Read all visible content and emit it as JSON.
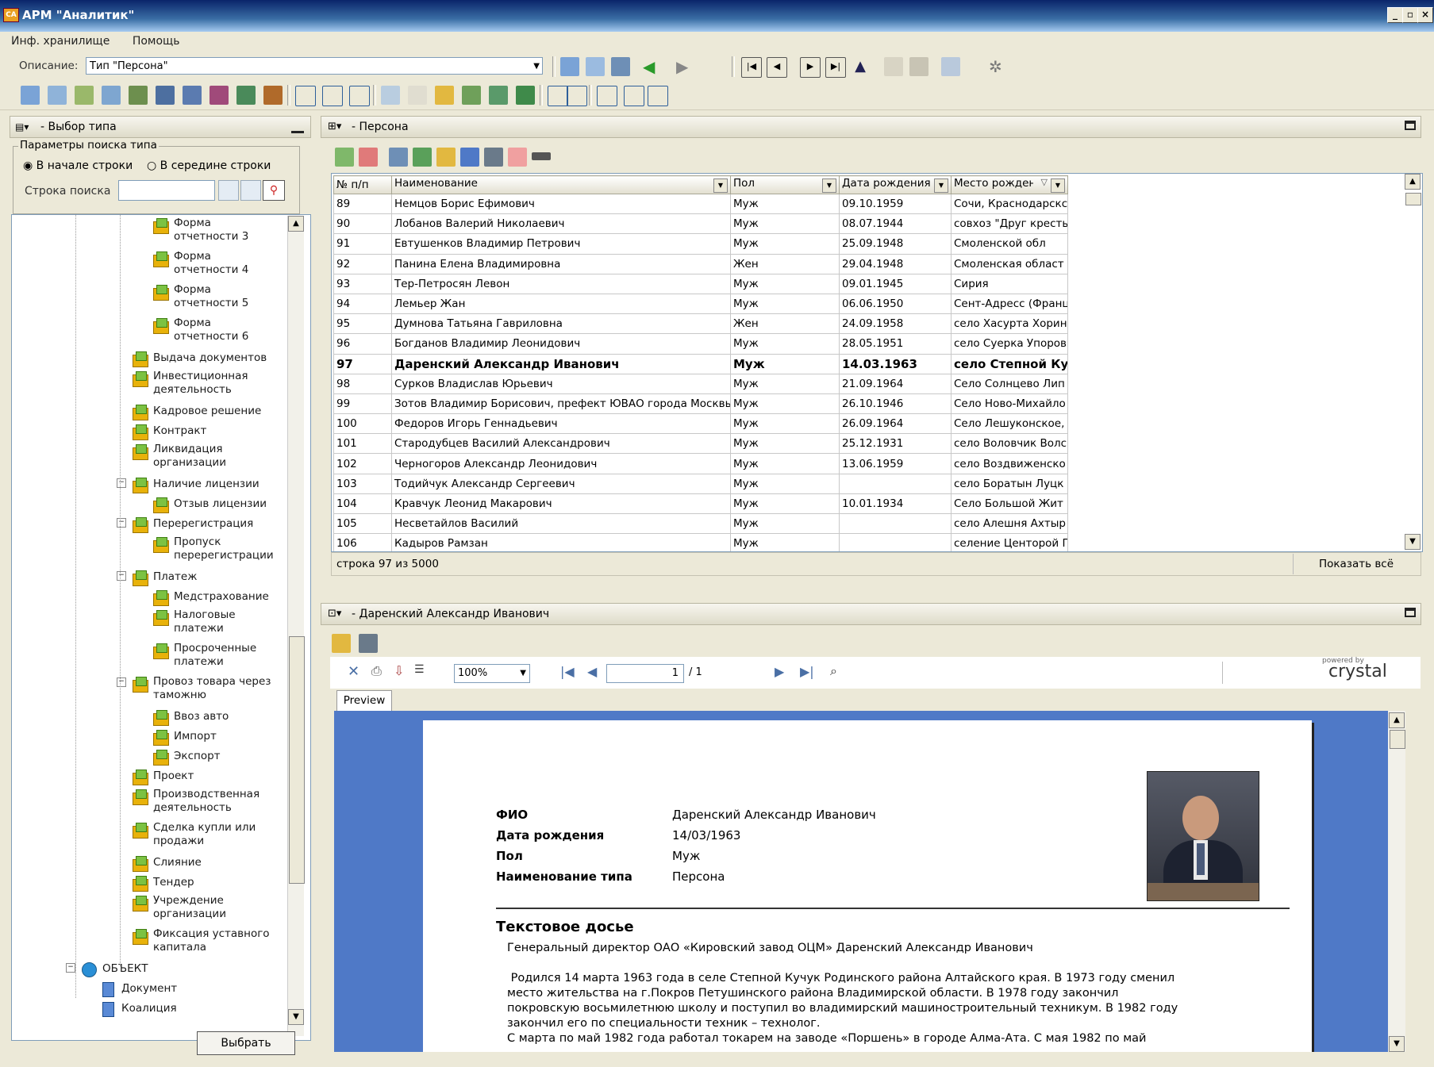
{
  "window": {
    "title": "АРМ \"Аналитик\""
  },
  "menu": [
    "Инф. хранилище",
    "Помощь"
  ],
  "toolbar": {
    "description_label": "Описание:",
    "description_value": "Тип \"Персона\""
  },
  "left_panel": {
    "title": "- Выбор типа",
    "search_group": "Параметры поиска типа",
    "radio_start": "В начале строки",
    "radio_middle": "В середине строки",
    "search_label": "Строка поиска",
    "search_value": "",
    "select_button": "Выбрать",
    "tree": [
      {
        "label": "Форма\nотчетности 3",
        "level": 3
      },
      {
        "label": "Форма\nотчетности 4",
        "level": 3
      },
      {
        "label": "Форма\nотчетности 5",
        "level": 3
      },
      {
        "label": "Форма\nотчетности 6",
        "level": 3
      },
      {
        "label": "Выдача документов",
        "level": 2
      },
      {
        "label": "Инвестиционная\nдеятельность",
        "level": 2
      },
      {
        "label": "Кадровое решение",
        "level": 2
      },
      {
        "label": "Контракт",
        "level": 2
      },
      {
        "label": "Ликвидация\nорганизации",
        "level": 2
      },
      {
        "label": "Наличие лицензии",
        "level": 2,
        "expanded": true
      },
      {
        "label": "Отзыв лицензии",
        "level": 3
      },
      {
        "label": "Перерегистрация",
        "level": 2,
        "expanded": true
      },
      {
        "label": "Пропуск\nперерегистрации",
        "level": 3
      },
      {
        "label": "Платеж",
        "level": 2,
        "expanded": true
      },
      {
        "label": "Медстрахование",
        "level": 3
      },
      {
        "label": "Налоговые\nплатежи",
        "level": 3
      },
      {
        "label": "Просроченные\nплатежи",
        "level": 3
      },
      {
        "label": "Провоз товара через\nтаможню",
        "level": 2,
        "expanded": true
      },
      {
        "label": "Ввоз авто",
        "level": 3
      },
      {
        "label": "Импорт",
        "level": 3
      },
      {
        "label": "Экспорт",
        "level": 3
      },
      {
        "label": "Проект",
        "level": 2
      },
      {
        "label": "Производственная\nдеятельность",
        "level": 2
      },
      {
        "label": "Сделка купли или\nпродажи",
        "level": 2
      },
      {
        "label": "Слияние",
        "level": 2
      },
      {
        "label": "Тендер",
        "level": 2
      },
      {
        "label": "Учреждение\nорганизации",
        "level": 2
      },
      {
        "label": "Фиксация уставного\nкапитала",
        "level": 2
      },
      {
        "label": "ОБЪЕКТ",
        "level": 0,
        "expanded": true
      },
      {
        "label": "Документ",
        "level": 1
      },
      {
        "label": "Коалиция",
        "level": 1
      }
    ]
  },
  "grid_panel": {
    "title": "- Персона",
    "columns": [
      "№ п/п",
      "Наименование",
      "Пол",
      "Дата рождения",
      "Место рождения"
    ],
    "rows": [
      [
        "89",
        "Немцов Борис Ефимович",
        "Муж",
        "09.10.1959",
        "Сочи, Краснодарскс"
      ],
      [
        "90",
        "Лобанов Валерий Николаевич",
        "Муж",
        "08.07.1944",
        "совхоз \"Друг кресть"
      ],
      [
        "91",
        "Евтушенков Владимир Петрович",
        "Муж",
        "25.09.1948",
        "Смоленской обл"
      ],
      [
        "92",
        "Панина Елена Владимировна",
        "Жен",
        "29.04.1948",
        "Смоленская област"
      ],
      [
        "93",
        "Тер-Петросян Левон",
        "Муж",
        "09.01.1945",
        "Сирия"
      ],
      [
        "94",
        "Лемьер Жан",
        "Муж",
        "06.06.1950",
        "Сент-Адресс (Франц"
      ],
      [
        "95",
        "Думнова Татьяна Гавриловна",
        "Жен",
        "24.09.1958",
        "село Хасурта Хорин"
      ],
      [
        "96",
        "Богданов Владимир Леонидович",
        "Муж",
        "28.05.1951",
        "село Суерка Упоров"
      ],
      [
        "97",
        "Даренский Александр Иванович",
        "Муж",
        "14.03.1963",
        "село Степной Ку"
      ],
      [
        "98",
        "Сурков Владислав Юрьевич",
        "Муж",
        "21.09.1964",
        "Село Солнцево Лип"
      ],
      [
        "99",
        "Зотов Владимир Борисович, префект ЮВАО города Москвы",
        "Муж",
        "26.10.1946",
        "Село Ново-Михайло"
      ],
      [
        "100",
        "Федоров Игорь Геннадьевич",
        "Муж",
        "26.09.1964",
        "Село Лешуконское,"
      ],
      [
        "101",
        "Стародубцев Василий Александрович",
        "Муж",
        "25.12.1931",
        "село Воловчик Волс"
      ],
      [
        "102",
        "Черногоров Александр Леонидович",
        "Муж",
        "13.06.1959",
        "село Воздвиженско"
      ],
      [
        "103",
        "Тодийчук Александр Сергеевич",
        "Муж",
        "",
        "село Боратын Луцк"
      ],
      [
        "104",
        "Кравчук Леонид Макарович",
        "Муж",
        "10.01.1934",
        "Село Большой Жит"
      ],
      [
        "105",
        "Несветайлов Василий",
        "Муж",
        "",
        "село Алешня Ахтыр"
      ],
      [
        "106",
        "Кадыров Рамзан",
        "Муж",
        "",
        "селение Центорой Г"
      ]
    ],
    "selected_row_index": 8,
    "status": "строка 97 из 5000",
    "show_all": "Показать всё"
  },
  "report_panel": {
    "title": "- Даренский Александр Иванович",
    "zoom": "100%",
    "page_current": "1",
    "page_total": "/ 1",
    "preview_tab": "Preview",
    "brand_small": "powered by",
    "brand": "crystal",
    "fields": [
      {
        "label": "ФИО",
        "value": "Даренский Александр Иванович"
      },
      {
        "label": "Дата рождения",
        "value": "14/03/1963"
      },
      {
        "label": "Пол",
        "value": "Муж"
      },
      {
        "label": "Наименование типа",
        "value": "Персона"
      }
    ],
    "dossier_title": "Текстовое досье",
    "dossier_lines": [
      "Генеральный директор ОАО «Кировский завод ОЦМ» Даренский Александр Иванович",
      "",
      " Родился 14 марта 1963 года в селе Степной Кучук Родинского района Алтайского края. В 1973 году сменил",
      "место жительства на г.Покров Петушинского района Владимирской области. В 1978 году закончил",
      "покровскую восьмилетнюю школу и поступил во владимирский машиностроительный техникум. В 1982 году",
      "закончил его по специальности техник – технолог.",
      "С марта по май 1982 года работал токарем на заводе «Поршень» в городе Алма-Ата. С мая 1982 по май"
    ]
  }
}
